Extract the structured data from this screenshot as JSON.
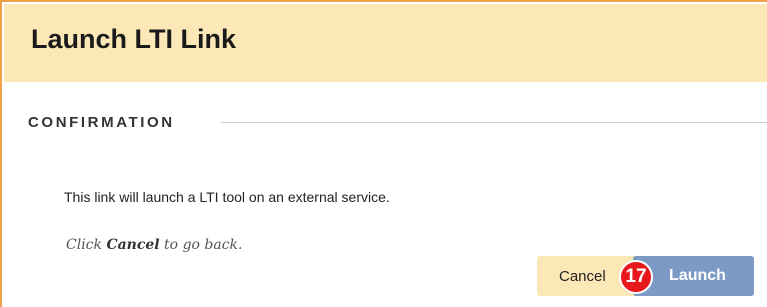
{
  "header": {
    "title": "Launch LTI Link"
  },
  "section": {
    "label": "CONFIRMATION"
  },
  "body": {
    "message": "This link will launch a LTI tool on an external service.",
    "hint_prefix": "Click ",
    "hint_emphasis": "Cancel",
    "hint_suffix": " to go back."
  },
  "actions": {
    "cancel_label": "Cancel",
    "launch_label": "Launch"
  },
  "annotation": {
    "step_number": "17"
  },
  "colors": {
    "header_bg": "#fbe8b6",
    "frame_border": "#f0a04a",
    "launch_button": "#7d9ac6",
    "step_badge": "#e8191c"
  }
}
